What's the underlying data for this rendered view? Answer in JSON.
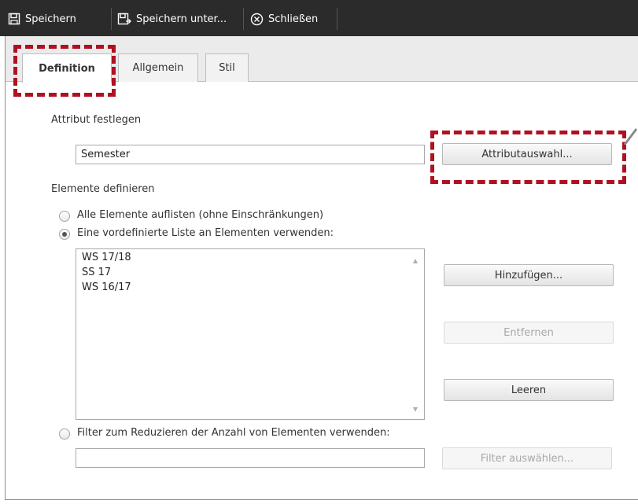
{
  "toolbar": {
    "save_label": "Speichern",
    "save_as_label": "Speichern unter...",
    "close_label": "Schließen"
  },
  "tabs": [
    {
      "label": "Definition",
      "active": true
    },
    {
      "label": "Allgemein",
      "active": false
    },
    {
      "label": "Stil",
      "active": false
    }
  ],
  "attribute_section": {
    "heading": "Attribut festlegen",
    "value": "Semester",
    "select_button": "Attributauswahl..."
  },
  "elements_section": {
    "heading": "Elemente definieren",
    "option_all": "Alle Elemente auflisten (ohne Einschränkungen)",
    "option_predefined": "Eine vordefinierte Liste an Elementen verwenden:",
    "option_filter": "Filter zum Reduzieren der Anzahl von Elementen verwenden:",
    "selected_option": "predefined",
    "list_items": [
      "WS 17/18",
      "SS 17",
      "WS 16/17"
    ],
    "add_button": "Hinzufügen...",
    "remove_button": "Entfernen",
    "clear_button": "Leeren",
    "filter_value": "",
    "filter_button": "Filter auswählen..."
  },
  "colors": {
    "toolbar_bg": "#2b2b2b",
    "highlight": "#b01020"
  }
}
